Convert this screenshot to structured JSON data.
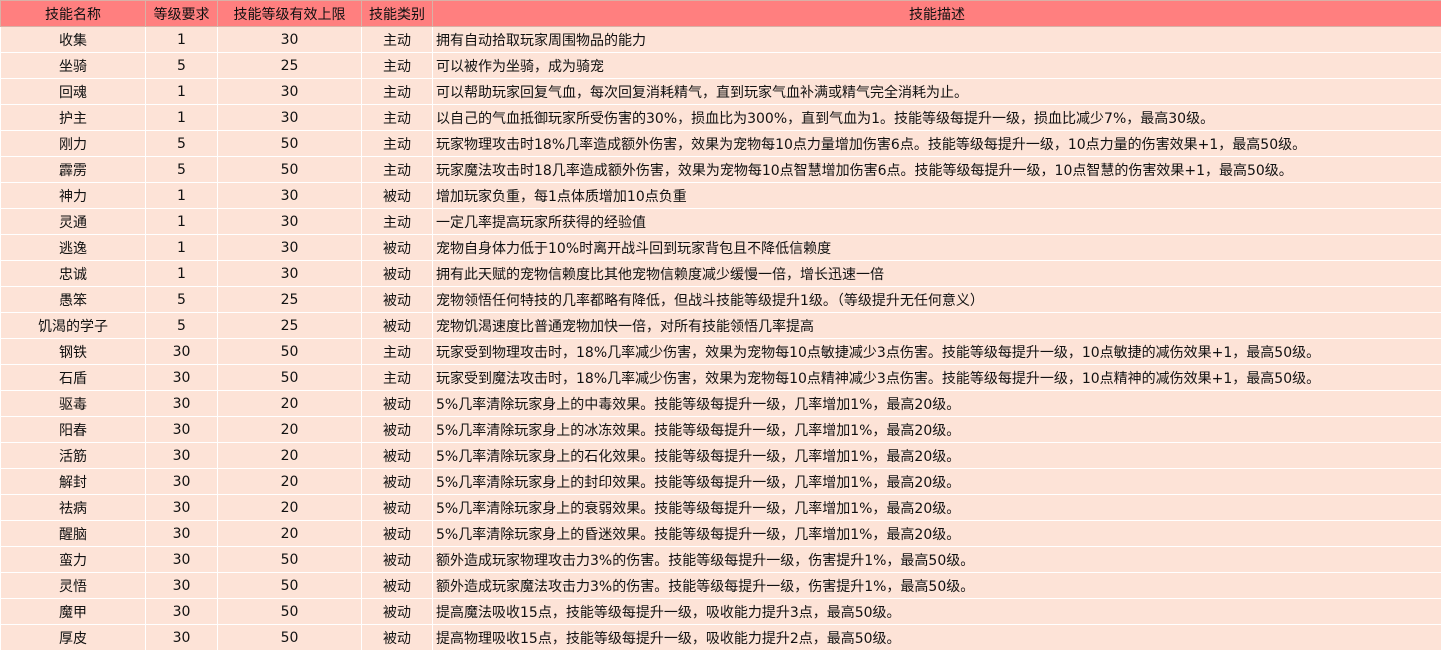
{
  "headers": [
    "技能名称",
    "等级要求",
    "技能等级有效上限",
    "技能类别",
    "技能描述"
  ],
  "rows": [
    {
      "name": "收集",
      "level": "1",
      "cap": "30",
      "type": "主动",
      "desc": "拥有自动拾取玩家周围物品的能力"
    },
    {
      "name": "坐骑",
      "level": "5",
      "cap": "25",
      "type": "主动",
      "desc": "可以被作为坐骑，成为骑宠"
    },
    {
      "name": "回魂",
      "level": "1",
      "cap": "30",
      "type": "主动",
      "desc": "可以帮助玩家回复气血，每次回复消耗精气，直到玩家气血补满或精气完全消耗为止。"
    },
    {
      "name": "护主",
      "level": "1",
      "cap": "30",
      "type": "主动",
      "desc": "以自己的气血抵御玩家所受伤害的30%，损血比为300%，直到气血为1。技能等级每提升一级，损血比减少7%，最高30级。"
    },
    {
      "name": "刚力",
      "level": "5",
      "cap": "50",
      "type": "主动",
      "desc": "玩家物理攻击时18%几率造成额外伤害，效果为宠物每10点力量增加伤害6点。技能等级每提升一级，10点力量的伤害效果+1，最高50级。"
    },
    {
      "name": "霹雳",
      "level": "5",
      "cap": "50",
      "type": "主动",
      "desc": "玩家魔法攻击时18几率造成额外伤害，效果为宠物每10点智慧增加伤害6点。技能等级每提升一级，10点智慧的伤害效果+1，最高50级。"
    },
    {
      "name": "神力",
      "level": "1",
      "cap": "30",
      "type": "被动",
      "desc": "增加玩家负重，每1点体质增加10点负重"
    },
    {
      "name": "灵通",
      "level": "1",
      "cap": "30",
      "type": "主动",
      "desc": "一定几率提高玩家所获得的经验值"
    },
    {
      "name": "逃逸",
      "level": "1",
      "cap": "30",
      "type": "被动",
      "desc": "宠物自身体力低于10%时离开战斗回到玩家背包且不降低信赖度"
    },
    {
      "name": "忠诚",
      "level": "1",
      "cap": "30",
      "type": "被动",
      "desc": "拥有此天赋的宠物信赖度比其他宠物信赖度减少缓慢一倍，增长迅速一倍"
    },
    {
      "name": "愚笨",
      "level": "5",
      "cap": "25",
      "type": "被动",
      "desc": "宠物领悟任何特技的几率都略有降低，但战斗技能等级提升1级。（等级提升无任何意义）"
    },
    {
      "name": "饥渴的学子",
      "level": "5",
      "cap": "25",
      "type": "被动",
      "desc": "宠物饥渴速度比普通宠物加快一倍，对所有技能领悟几率提高"
    },
    {
      "name": "钢铁",
      "level": "30",
      "cap": "50",
      "type": "主动",
      "desc": "玩家受到物理攻击时，18%几率减少伤害，效果为宠物每10点敏捷减少3点伤害。技能等级每提升一级，10点敏捷的减伤效果+1，最高50级。"
    },
    {
      "name": "石盾",
      "level": "30",
      "cap": "50",
      "type": "主动",
      "desc": "玩家受到魔法攻击时，18%几率减少伤害，效果为宠物每10点精神减少3点伤害。技能等级每提升一级，10点精神的减伤效果+1，最高50级。"
    },
    {
      "name": "驱毒",
      "level": "30",
      "cap": "20",
      "type": "被动",
      "desc": "5%几率清除玩家身上的中毒效果。技能等级每提升一级，几率增加1%，最高20级。"
    },
    {
      "name": "阳春",
      "level": "30",
      "cap": "20",
      "type": "被动",
      "desc": "5%几率清除玩家身上的冰冻效果。技能等级每提升一级，几率增加1%，最高20级。"
    },
    {
      "name": "活筋",
      "level": "30",
      "cap": "20",
      "type": "被动",
      "desc": "5%几率清除玩家身上的石化效果。技能等级每提升一级，几率增加1%，最高20级。"
    },
    {
      "name": "解封",
      "level": "30",
      "cap": "20",
      "type": "被动",
      "desc": "5%几率清除玩家身上的封印效果。技能等级每提升一级，几率增加1%，最高20级。"
    },
    {
      "name": "祛病",
      "level": "30",
      "cap": "20",
      "type": "被动",
      "desc": "5%几率清除玩家身上的衰弱效果。技能等级每提升一级，几率增加1%，最高20级。"
    },
    {
      "name": "醒脑",
      "level": "30",
      "cap": "20",
      "type": "被动",
      "desc": "5%几率清除玩家身上的昏迷效果。技能等级每提升一级，几率增加1%，最高20级。"
    },
    {
      "name": "蛮力",
      "level": "30",
      "cap": "50",
      "type": "被动",
      "desc": "额外造成玩家物理攻击力3%的伤害。技能等级每提升一级，伤害提升1%，最高50级。"
    },
    {
      "name": "灵悟",
      "level": "30",
      "cap": "50",
      "type": "被动",
      "desc": "额外造成玩家魔法攻击力3%的伤害。技能等级每提升一级，伤害提升1%，最高50级。"
    },
    {
      "name": "魔甲",
      "level": "30",
      "cap": "50",
      "type": "被动",
      "desc": "提高魔法吸收15点，技能等级每提升一级，吸收能力提升3点，最高50级。"
    },
    {
      "name": "厚皮",
      "level": "30",
      "cap": "50",
      "type": "被动",
      "desc": "提高物理吸收15点，技能等级每提升一级，吸收能力提升2点，最高50级。"
    }
  ]
}
